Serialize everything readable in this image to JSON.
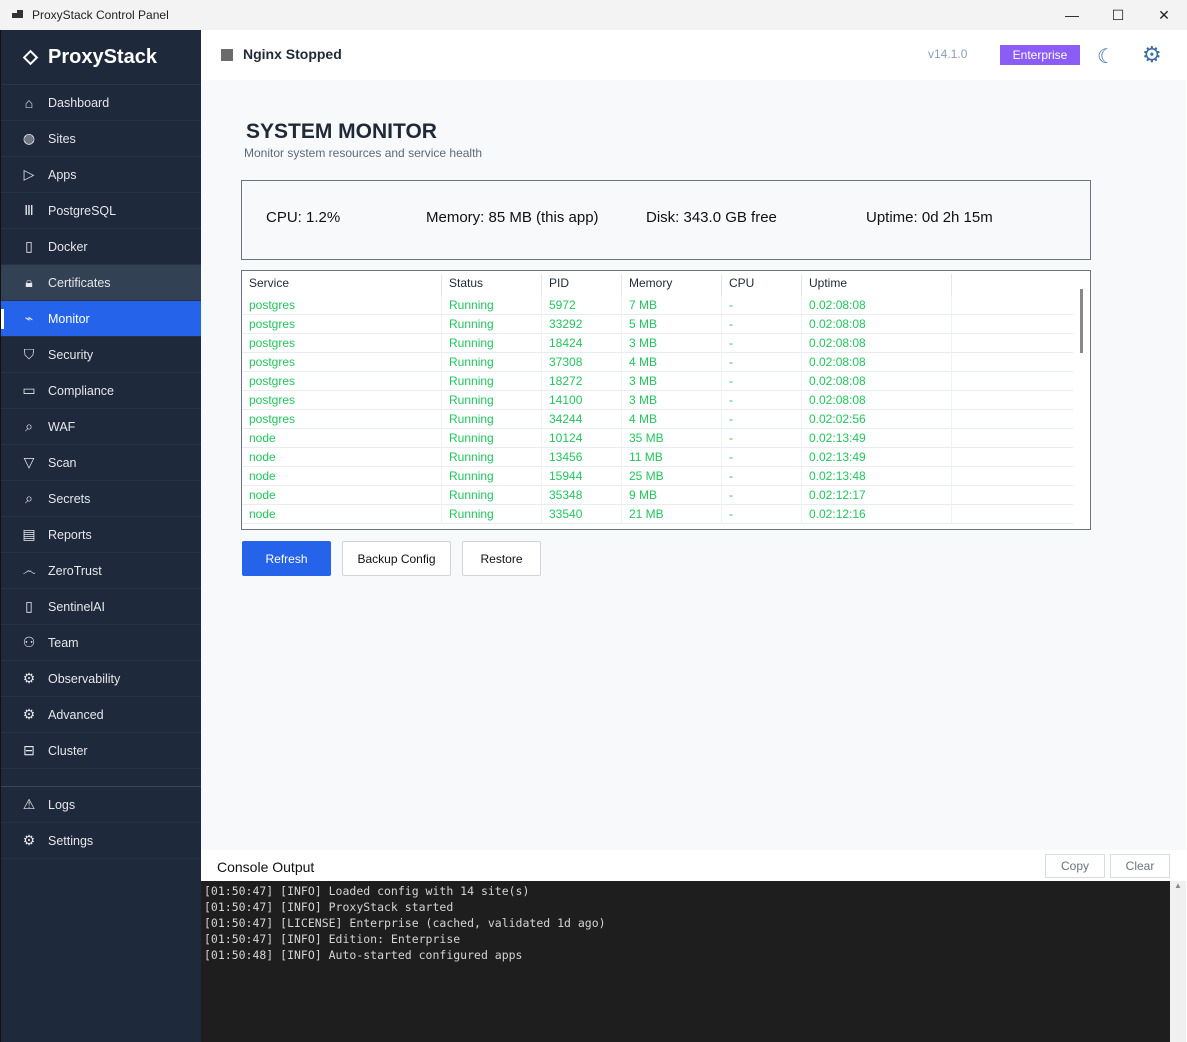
{
  "window": {
    "title": "ProxyStack Control Panel",
    "minimize": "—",
    "maximize": "☐",
    "close": "✕"
  },
  "sidebar": {
    "brand": "ProxyStack",
    "items": [
      {
        "label": "Dashboard",
        "icon": "home-icon",
        "glyph": "⌂"
      },
      {
        "label": "Sites",
        "icon": "globe-icon",
        "glyph": "◍"
      },
      {
        "label": "Apps",
        "icon": "play-icon",
        "glyph": "▷"
      },
      {
        "label": "PostgreSQL",
        "icon": "library-icon",
        "glyph": "Ⅲ"
      },
      {
        "label": "Docker",
        "icon": "container-icon",
        "glyph": "▯"
      },
      {
        "label": "Certificates",
        "icon": "lock-icon",
        "glyph": "🔒︎",
        "state": "hover"
      },
      {
        "label": "Monitor",
        "icon": "activity-chart-icon",
        "glyph": "⌁",
        "state": "active"
      },
      {
        "label": "Security",
        "icon": "shield-icon",
        "glyph": "⛉"
      },
      {
        "label": "Compliance",
        "icon": "laptop-icon",
        "glyph": "▭"
      },
      {
        "label": "WAF",
        "icon": "zoom-icon",
        "glyph": "⌕"
      },
      {
        "label": "Scan",
        "icon": "filter-icon",
        "glyph": "▽"
      },
      {
        "label": "Secrets",
        "icon": "key-search-icon",
        "glyph": "⌕"
      },
      {
        "label": "Reports",
        "icon": "report-icon",
        "glyph": "▤"
      },
      {
        "label": "ZeroTrust",
        "icon": "fingerprint-icon",
        "glyph": "෴"
      },
      {
        "label": "SentinelAI",
        "icon": "device-icon",
        "glyph": "▯"
      },
      {
        "label": "Team",
        "icon": "people-icon",
        "glyph": "⚇"
      },
      {
        "label": "Observability",
        "icon": "gears-icon",
        "glyph": "⚙"
      },
      {
        "label": "Advanced",
        "icon": "gear-icon",
        "glyph": "⚙"
      },
      {
        "label": "Cluster",
        "icon": "server-icon",
        "glyph": "⊟"
      }
    ],
    "bottom": [
      {
        "label": "Logs",
        "icon": "warning-icon",
        "glyph": "⚠"
      },
      {
        "label": "Settings",
        "icon": "gear-icon",
        "glyph": "⚙"
      }
    ]
  },
  "header": {
    "status": "Nginx Stopped",
    "version": "v14.1.0",
    "edition": "Enterprise"
  },
  "page": {
    "title": "SYSTEM MONITOR",
    "subtitle": "Monitor system resources and service health"
  },
  "stats": {
    "cpu": "CPU: 1.2%",
    "memory": "Memory: 85 MB (this app)",
    "disk": "Disk: 343.0 GB free",
    "uptime": "Uptime: 0d 2h 15m"
  },
  "table": {
    "columns": [
      "Service",
      "Status",
      "PID",
      "Memory",
      "CPU",
      "Uptime"
    ],
    "rows": [
      [
        "postgres",
        "Running",
        "5972",
        "7 MB",
        "-",
        "0.02:08:08"
      ],
      [
        "postgres",
        "Running",
        "33292",
        "5 MB",
        "-",
        "0.02:08:08"
      ],
      [
        "postgres",
        "Running",
        "18424",
        "3 MB",
        "-",
        "0.02:08:08"
      ],
      [
        "postgres",
        "Running",
        "37308",
        "4 MB",
        "-",
        "0.02:08:08"
      ],
      [
        "postgres",
        "Running",
        "18272",
        "3 MB",
        "-",
        "0.02:08:08"
      ],
      [
        "postgres",
        "Running",
        "14100",
        "3 MB",
        "-",
        "0.02:08:08"
      ],
      [
        "postgres",
        "Running",
        "34244",
        "4 MB",
        "-",
        "0.02:02:56"
      ],
      [
        "node",
        "Running",
        "10124",
        "35 MB",
        "-",
        "0.02:13:49"
      ],
      [
        "node",
        "Running",
        "13456",
        "11 MB",
        "-",
        "0.02:13:49"
      ],
      [
        "node",
        "Running",
        "15944",
        "25 MB",
        "-",
        "0.02:13:48"
      ],
      [
        "node",
        "Running",
        "35348",
        "9 MB",
        "-",
        "0.02:12:17"
      ],
      [
        "node",
        "Running",
        "33540",
        "21 MB",
        "-",
        "0.02:12:16"
      ]
    ]
  },
  "actions": {
    "refresh": "Refresh",
    "backup": "Backup Config",
    "restore": "Restore"
  },
  "console": {
    "title": "Console Output",
    "copy": "Copy",
    "clear": "Clear",
    "lines": [
      "[01:50:47] [INFO] Loaded config with 14 site(s)",
      "[01:50:47] [INFO] ProxyStack started",
      "[01:50:47] [LICENSE] Enterprise (cached, validated 1d ago)",
      "[01:50:47] [INFO] Edition: Enterprise",
      "[01:50:48] [INFO] Auto-started configured apps"
    ]
  }
}
